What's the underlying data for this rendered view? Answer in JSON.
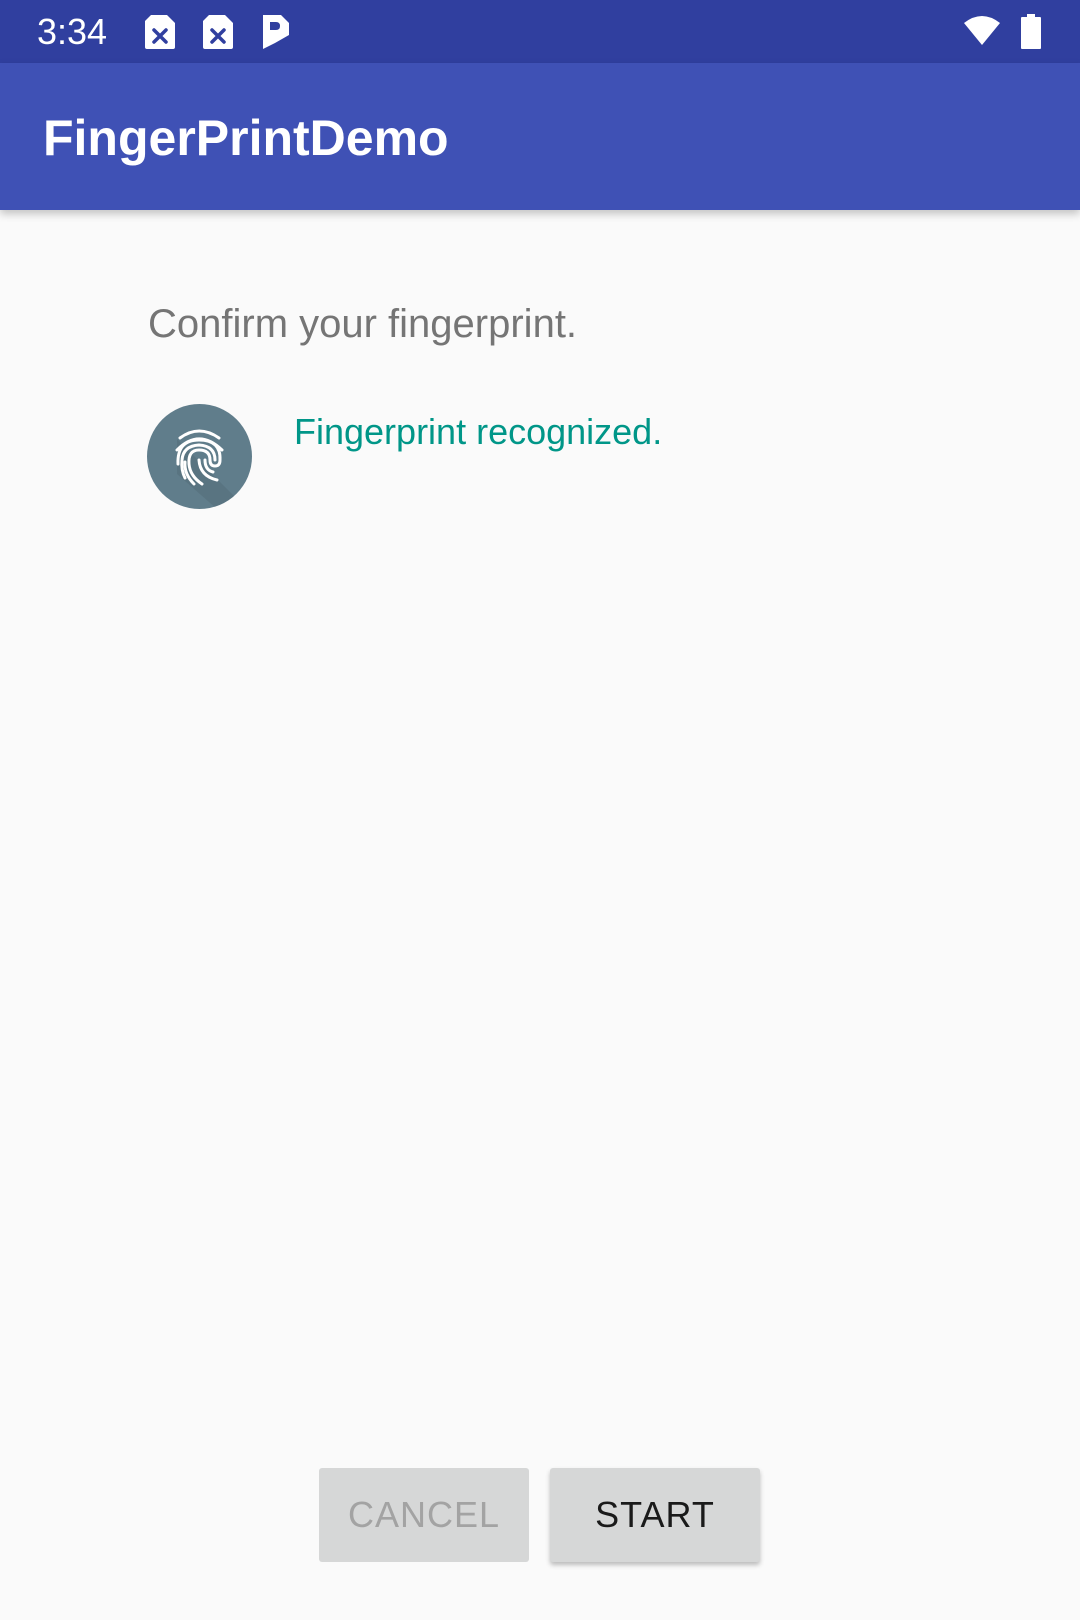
{
  "status_bar": {
    "time": "3:34",
    "icons": [
      "sim-no-card-icon",
      "sim-no-card-icon",
      "parking-icon",
      "wifi-icon",
      "battery-icon"
    ]
  },
  "app_bar": {
    "title": "FingerPrintDemo",
    "color": "#3f51b5"
  },
  "main": {
    "prompt": "Confirm your fingerprint.",
    "fingerprint_icon": "fingerprint-icon",
    "status_message": "Fingerprint recognized.",
    "status_color": "#009688"
  },
  "buttons": {
    "cancel_label": "CANCEL",
    "start_label": "START"
  }
}
